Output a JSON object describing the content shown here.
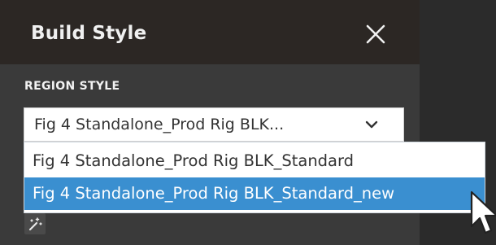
{
  "dialog": {
    "title": "Build Style",
    "close_icon": "close-x-icon"
  },
  "region_style": {
    "label": "REGION STYLE",
    "selected_value": "Fig 4 Standalone_Prod Rig BLK...",
    "dropdown_icon": "chevron-down-icon",
    "options": [
      "Fig 4 Standalone_Prod Rig BLK_Standard",
      "Fig 4 Standalone_Prod Rig BLK_Standard_new"
    ],
    "highlighted_option": "Fig 4 Standalone_Prod Rig BLK_Standard_new"
  },
  "tools": {
    "magic_wand_icon": "magic-wand-icon"
  },
  "colors": {
    "header_bg": "#2c2724",
    "panel_bg": "#3a3a3a",
    "highlight": "#3a8fd0"
  }
}
